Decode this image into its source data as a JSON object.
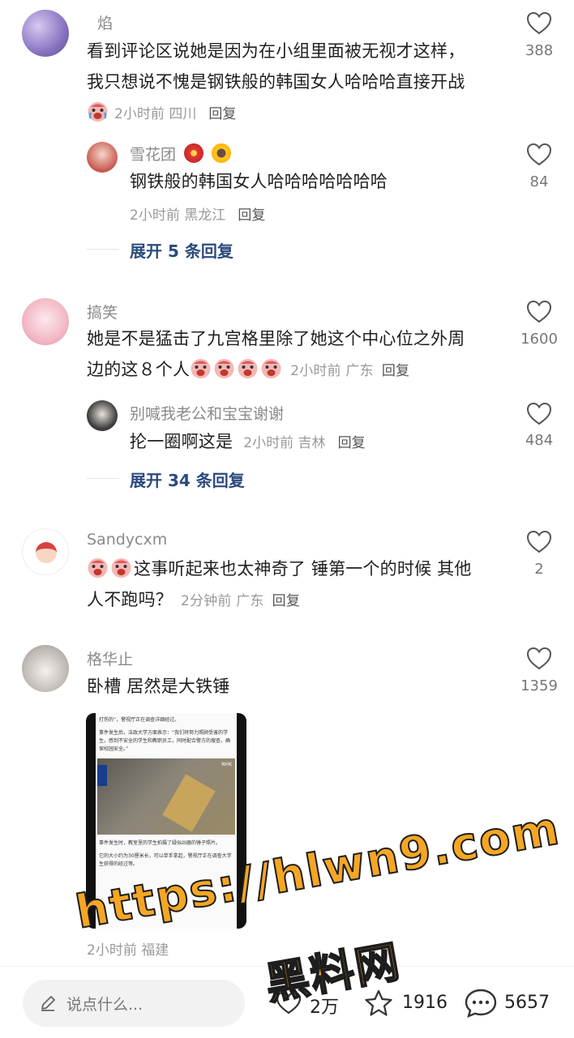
{
  "comments": [
    {
      "user": "焰",
      "text_line1": "看到评论区说她是因为在小组里面被无视才这样，",
      "text_line2": "我只想说不愧是钢铁般的韩国女人哈哈哈直接开战",
      "meta": "2小时前 四川",
      "reply_label": "回复",
      "likes": "388",
      "replies": [
        {
          "user": "雪花团",
          "text": "钢铁般的韩国女人哈哈哈哈哈哈哈",
          "meta": "2小时前 黑龙江",
          "reply_label": "回复",
          "likes": "84"
        }
      ],
      "expand": "展开 5 条回复"
    },
    {
      "user": "搞笑",
      "text_line1": "她是不是猛击了九宫格里除了她这个中心位之外周",
      "text_line2": "边的这８个人",
      "meta": "2小时前 广东",
      "reply_label": "回复",
      "likes": "1600",
      "replies": [
        {
          "user": "别喊我老公和宝宝谢谢",
          "text": "抡一圈啊这是",
          "meta": "2小时前 吉林",
          "reply_label": "回复",
          "likes": "484"
        }
      ],
      "expand": "展开 34 条回复"
    },
    {
      "user": "Sandycxm",
      "text_line1": "这事听起来也太神奇了 锤第一个的时候 其他",
      "text_line2": "人不跑吗？",
      "meta": "2分钟前 广东",
      "reply_label": "回复",
      "likes": "2"
    },
    {
      "user": "格华止",
      "text_line1": "卧槽 居然是大铁锤",
      "likes": "1359",
      "meta_partial": "2小时前 福建"
    }
  ],
  "screenshot": {
    "line1": "打伤的”，警视厅正在调查详细经过。",
    "para2": "事件发生后，法政大学方面表示：“我们将努力照顾受害的学生，感到不安全的学生和教职员工，同时配合警方的搜查，确保校园安全。”",
    "broadcaster": "NHK",
    "caption": "事件发生时，教室里的学生拍摄了疑似凶器的锤子照片。",
    "para3": "它的大小约为30厘米长，可以单手拿起，警视厅正在调查大学生获得的经过等。"
  },
  "bottom_bar": {
    "input_placeholder": "说点什么...",
    "likes": "2万",
    "favorites": "1916",
    "comments": "5657"
  },
  "watermark": {
    "url": "https://hlwn9.com",
    "name": "黑料网"
  }
}
